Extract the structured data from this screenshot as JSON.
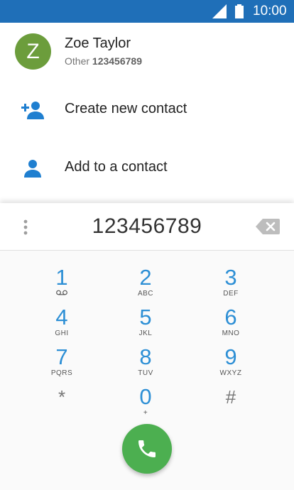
{
  "status_bar": {
    "time": "10:00",
    "signal_icon": "signal-icon",
    "battery_icon": "battery-icon"
  },
  "contact": {
    "avatar_letter": "Z",
    "avatar_color": "#6c9d3c",
    "name": "Zoe Taylor",
    "phone_type": "Other",
    "phone_number": "123456789"
  },
  "actions": {
    "create_label": "Create new contact",
    "add_label": "Add to a contact"
  },
  "dialpad": {
    "digits": "123456789",
    "keys": [
      {
        "num": "1",
        "letters": ""
      },
      {
        "num": "2",
        "letters": "ABC"
      },
      {
        "num": "3",
        "letters": "DEF"
      },
      {
        "num": "4",
        "letters": "GHI"
      },
      {
        "num": "5",
        "letters": "JKL"
      },
      {
        "num": "6",
        "letters": "MNO"
      },
      {
        "num": "7",
        "letters": "PQRS"
      },
      {
        "num": "8",
        "letters": "TUV"
      },
      {
        "num": "9",
        "letters": "WXYZ"
      },
      {
        "num": "*",
        "letters": ""
      },
      {
        "num": "0",
        "letters": "+"
      },
      {
        "num": "#",
        "letters": ""
      }
    ]
  },
  "colors": {
    "status_bar": "#1f6fb8",
    "accent_blue": "#2d8fd5",
    "call_green": "#4caf50"
  }
}
